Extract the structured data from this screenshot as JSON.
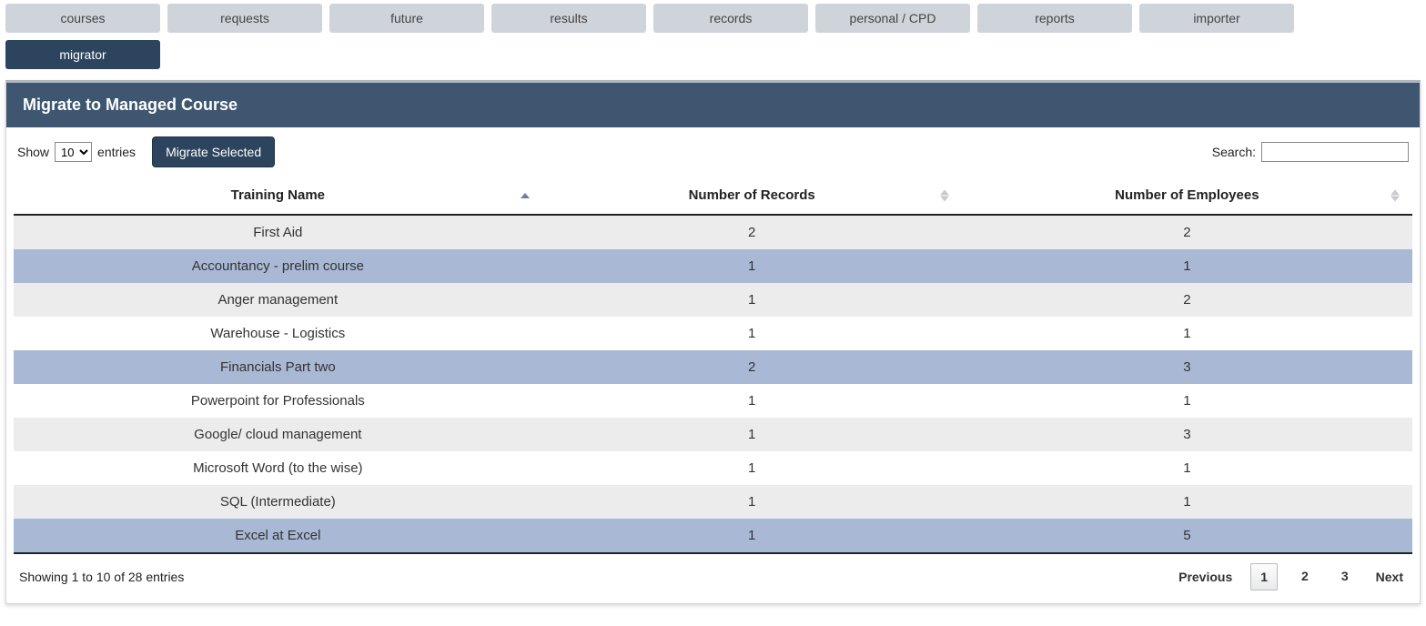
{
  "tabs_row1": [
    {
      "id": "courses",
      "label": "courses"
    },
    {
      "id": "requests",
      "label": "requests"
    },
    {
      "id": "future",
      "label": "future"
    },
    {
      "id": "results",
      "label": "results"
    },
    {
      "id": "records",
      "label": "records"
    },
    {
      "id": "personal-cpd",
      "label": "personal / CPD"
    },
    {
      "id": "reports",
      "label": "reports"
    },
    {
      "id": "importer",
      "label": "importer"
    }
  ],
  "tabs_row2": [
    {
      "id": "migrator",
      "label": "migrator",
      "active": true
    }
  ],
  "panel": {
    "title": "Migrate to Managed Course"
  },
  "controls": {
    "show_label": "Show",
    "entries_label": "entries",
    "page_size": "10",
    "migrate_button": "Migrate Selected",
    "search_label": "Search:",
    "search_value": ""
  },
  "table": {
    "columns": [
      {
        "key": "name",
        "label": "Training Name",
        "sort": "asc"
      },
      {
        "key": "records",
        "label": "Number of Records",
        "sort": "both"
      },
      {
        "key": "employees",
        "label": "Number of Employees",
        "sort": "both"
      }
    ],
    "rows": [
      {
        "name": " First Aid",
        "records": "2",
        "employees": "2",
        "stripe": "odd",
        "selected": false
      },
      {
        "name": "Accountancy - prelim course",
        "records": "1",
        "employees": "1",
        "stripe": "even",
        "selected": true
      },
      {
        "name": "Anger management",
        "records": "1",
        "employees": "2",
        "stripe": "odd",
        "selected": false
      },
      {
        "name": "Warehouse - Logistics",
        "records": "1",
        "employees": "1",
        "stripe": "even",
        "selected": false
      },
      {
        "name": "Financials Part two",
        "records": "2",
        "employees": "3",
        "stripe": "odd",
        "selected": true
      },
      {
        "name": "Powerpoint for Professionals",
        "records": "1",
        "employees": "1",
        "stripe": "even",
        "selected": false
      },
      {
        "name": "Google/ cloud management",
        "records": "1",
        "employees": "3",
        "stripe": "odd",
        "selected": false
      },
      {
        "name": "Microsoft Word (to the wise)",
        "records": "1",
        "employees": "1",
        "stripe": "even",
        "selected": false
      },
      {
        "name": "SQL (Intermediate)",
        "records": "1",
        "employees": "1",
        "stripe": "odd",
        "selected": false
      },
      {
        "name": "Excel at Excel",
        "records": "1",
        "employees": "5",
        "stripe": "even",
        "selected": true
      }
    ]
  },
  "footer": {
    "info": "Showing 1 to 10 of 28 entries",
    "previous": "Previous",
    "next": "Next",
    "pages": [
      {
        "n": "1",
        "active": true
      },
      {
        "n": "2",
        "active": false
      },
      {
        "n": "3",
        "active": false
      }
    ]
  }
}
